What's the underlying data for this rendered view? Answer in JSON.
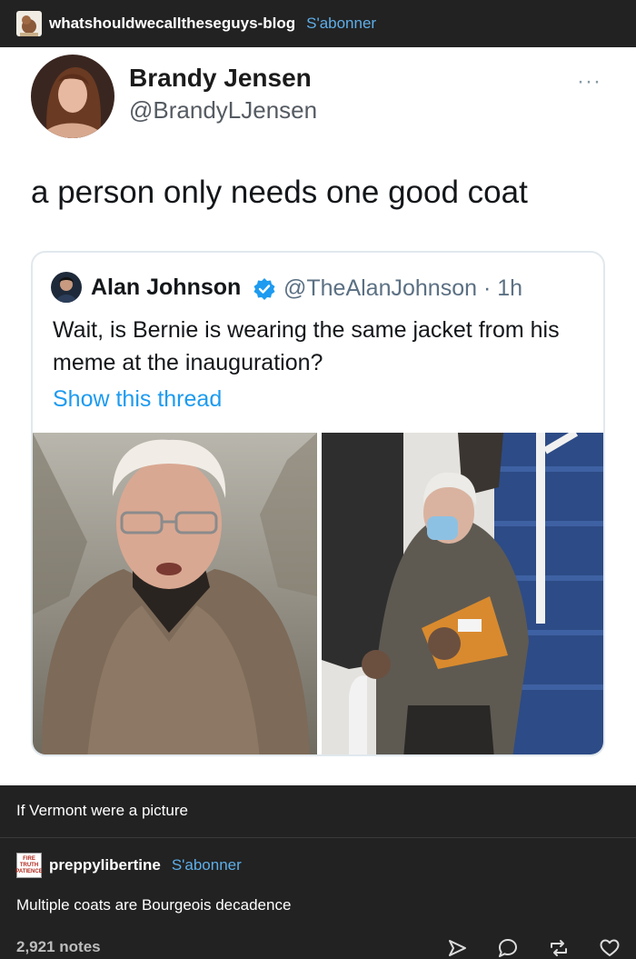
{
  "post": {
    "blog_name": "whatshouldwecalltheseguys-blog",
    "follow_label": "S'abonner"
  },
  "tweet": {
    "author_name": "Brandy Jensen",
    "author_handle": "@BrandyLJensen",
    "more_label": "···",
    "text": "a person only needs one good coat",
    "quoted": {
      "author_name": "Alan Johnson",
      "author_handle": "@TheAlanJohnson · 1h",
      "text": "Wait, is Bernie is wearing the same jacket from his meme at the inauguration?",
      "link_label": "Show this thread"
    }
  },
  "caption": "If Vermont were a picture",
  "reblog": {
    "blog_name": "preppylibertine",
    "follow_label": "S'abonner",
    "avatar_text": [
      "FIRE",
      "TRUTH",
      "PATIENCE"
    ],
    "text": "Multiple coats are Bourgeois decadence"
  },
  "footer": {
    "notes": "2,921 notes",
    "actions": [
      "share-icon",
      "reply-icon",
      "reblog-icon",
      "like-icon"
    ]
  },
  "colors": {
    "background": "#222222",
    "link_blue": "#5eaee8",
    "twitter_blue": "#1d9bf0"
  }
}
